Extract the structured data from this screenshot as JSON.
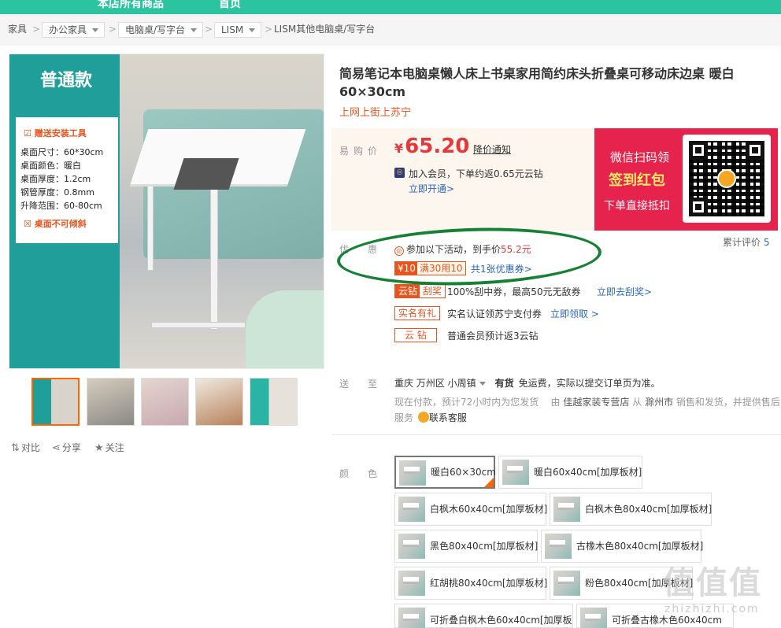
{
  "topbar": {
    "item1": "本店所有商品",
    "item2": "首页"
  },
  "breadcrumb": {
    "items": [
      "家具",
      "办公家具",
      "电脑桌/写字台",
      "LISM",
      "LISM其他电脑桌/写字台"
    ],
    "separator": ">"
  },
  "gallery": {
    "badge": "普通款",
    "gift": "赠送安装工具",
    "specs": [
      "桌面尺寸：60*30cm",
      "桌面颜色：暖白",
      "桌面厚度：1.2cm",
      "钢管厚度：0.8mm",
      "升降范围：60-80cm"
    ],
    "warning": "桌面不可倾斜",
    "thumb_count": 5
  },
  "actions": {
    "compare": "对比",
    "share": "分享",
    "follow": "关注"
  },
  "product": {
    "title": "简易笔记本电脑桌懒人床上书桌家用简约床头折叠桌可移动床边桌 暖白60×30cm",
    "subtitle": "上网上街上苏宁"
  },
  "price": {
    "label": "易购价",
    "currency": "¥",
    "value": "65.20",
    "notify": "降价通知",
    "member_text": "加入会员，下单约返0.65元云钻",
    "member_link": "立即开通>"
  },
  "promo": {
    "line1": "微信扫码领",
    "line2": "签到红包",
    "line3": "下单直接抵扣"
  },
  "reviews": {
    "label": "累计评价",
    "count": "5"
  },
  "discount": {
    "label": "优惠",
    "activity_prefix": "参加以下活动，到手价",
    "activity_price": "55.2元",
    "coupon_value": "¥10",
    "coupon_rule": "满30用10",
    "coupon_link": "共1张优惠券>",
    "rows": [
      {
        "tag": "云钻",
        "tag2": "刮奖",
        "text": "100%刮中券，最高50元无敌券",
        "link": "立即去刮奖>"
      },
      {
        "tag": "实名有礼",
        "text": "实名认证领苏宁支付券",
        "link": "立即领取 >"
      },
      {
        "tag": "云 钻",
        "text": "普通会员预计返3云钻",
        "link": ""
      }
    ]
  },
  "shipping": {
    "label": "送至",
    "location": "重庆 万州区 小周镇",
    "stock": "有货",
    "free": "免运费，实际以提交订单页为准。",
    "note_prefix": "现在付款，预计72小时内为您发货",
    "note_by": "由",
    "store": "佳越家装专营店",
    "note_mid": "从",
    "origin": "滁州市",
    "note_suffix": "销售和发货，并提供售后",
    "service_label": "服务",
    "service_link": "联系客服"
  },
  "colors": {
    "label": "颜色",
    "options": [
      "暖白60×30cm",
      "暖白60x40cm[加厚板材]",
      "白枫木60x40cm[加厚板材]",
      "白枫木色80x40cm[加厚板材]",
      "黑色80x40cm[加厚板材]",
      "古橡木色80x40cm[加厚板材]",
      "红胡桃80x40cm[加厚板材]",
      "粉色80x40cm[加厚板材]",
      "可折叠白枫木色60x40cm[加厚板",
      "可折叠古橡木色60x40cm"
    ],
    "selected": "暖白60×30cm"
  },
  "watermark": {
    "text": "值值值",
    "url": "zhizhizhi.com"
  },
  "accent": {
    "teal": "#2bc3a0",
    "price_red": "#e4393c",
    "orange": "#e8541e",
    "link_blue": "#2b66c3",
    "promo_red": "#e5234c"
  }
}
